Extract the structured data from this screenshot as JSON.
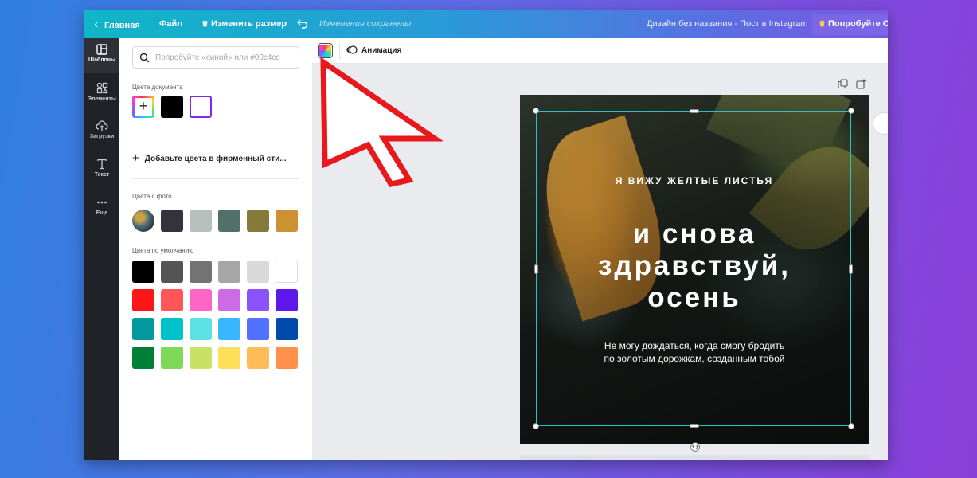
{
  "topbar": {
    "home": "Главная",
    "file": "Файл",
    "resize": "Изменить размер",
    "status": "Изменения сохранены",
    "doc_title": "Дизайн без названия - Пост в Instagram",
    "try_pro": "Попробуйте Ca"
  },
  "rail": {
    "templates": "Шаблоны",
    "elements": "Элементы",
    "uploads": "Загрузки",
    "text": "Текст",
    "more": "Еще"
  },
  "panel": {
    "search_placeholder": "Попробуйте «синий» или #00c4cc",
    "doc_colors_label": "Цвета документа",
    "add_brand_colors": "Добавьте цвета в фирменный сти...",
    "photo_colors_label": "Цвета с фото",
    "default_colors_label": "Цвета по умолчанию",
    "doc_colors": [
      "#000000",
      "#ffffff"
    ],
    "photo_colors": [
      "#33323d",
      "#b7c0bd",
      "#52706a",
      "#857a3c",
      "#cc9232"
    ],
    "default_colors": [
      [
        "#000000",
        "#545454",
        "#737373",
        "#a6a6a6",
        "#d9d9d9",
        "#ffffff"
      ],
      [
        "#ff1616",
        "#ff5757",
        "#ff66c4",
        "#cb6ce6",
        "#8c52ff",
        "#5e17eb"
      ],
      [
        "#03989e",
        "#00c2cb",
        "#5ce1e6",
        "#38b6ff",
        "#5271ff",
        "#004aad"
      ],
      [
        "#008037",
        "#7ed957",
        "#c9e265",
        "#ffde59",
        "#ffbd59",
        "#ff914d"
      ]
    ]
  },
  "toolbar": {
    "animation": "Анимация"
  },
  "design": {
    "subtitle": "Я ВИЖУ ЖЕЛТЫЕ ЛИСТЬЯ",
    "title_lines": [
      "и снова",
      "здравствуй,",
      "осень"
    ],
    "body_lines": [
      "Не могу дождаться, когда смогу бродить",
      "по золотым дорожкам, созданным тобой"
    ]
  },
  "colors": {
    "accent": "#7d2ae8",
    "selection": "#20c4cb",
    "annotation": "#e8191c"
  }
}
